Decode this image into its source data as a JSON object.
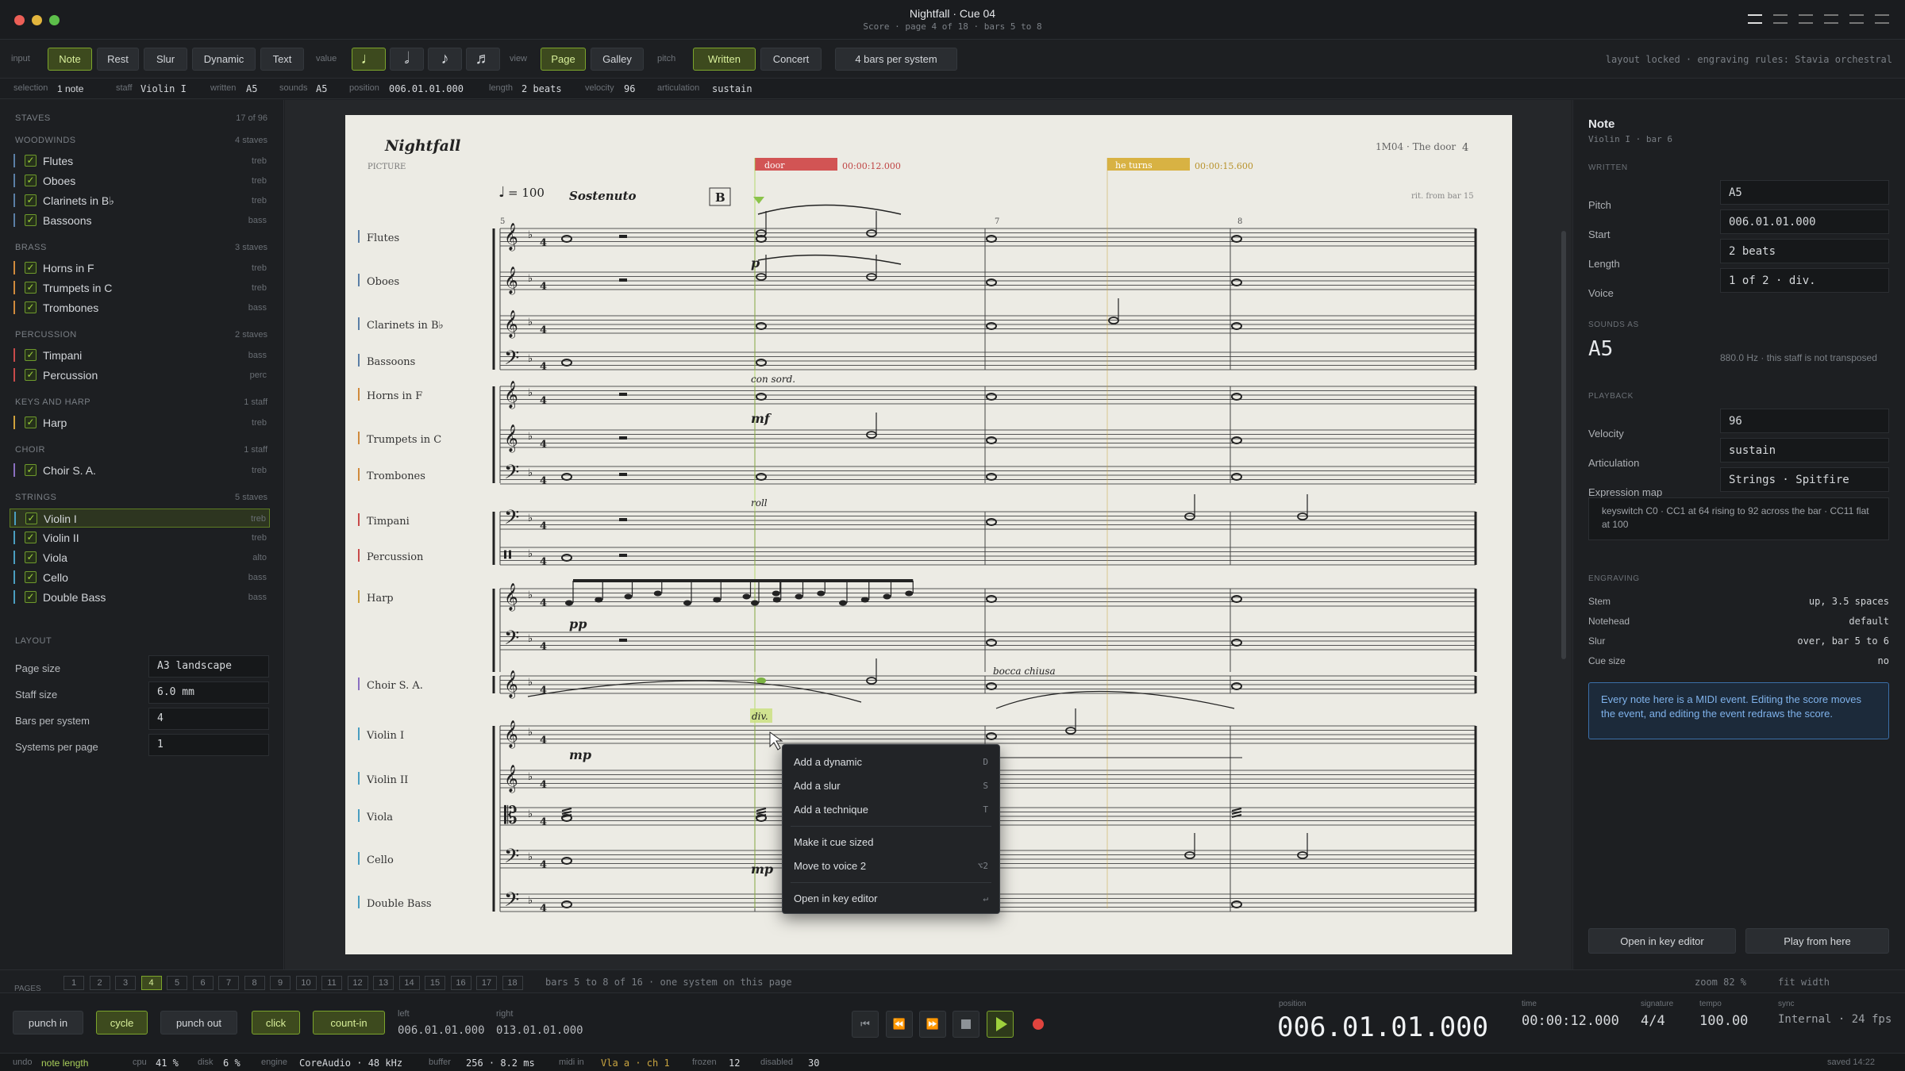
{
  "window": {
    "title": "Nightfall · Cue 04",
    "subtitle": "Score · page 4 of 18 · bars 5 to 8"
  },
  "toolbar": {
    "input_label": "input",
    "input_buttons": [
      "Note",
      "Rest",
      "Slur",
      "Dynamic",
      "Text"
    ],
    "value_label": "value",
    "view_label": "view",
    "view_buttons": [
      "Page",
      "Galley"
    ],
    "pitch_label": "pitch",
    "pitch_buttons": [
      "Written",
      "Concert"
    ],
    "bars_per_system": "4 bars per system",
    "right_status": "layout locked · engraving rules: Stavia orchestral"
  },
  "selection": {
    "selection_k": "selection",
    "selection_v": "1 note",
    "staff_k": "staff",
    "staff_v": "Violin I",
    "written_k": "written",
    "written_v": "A5",
    "sounds_k": "sounds",
    "sounds_v": "A5",
    "position_k": "position",
    "position_v": "006.01.01.000",
    "length_k": "length",
    "length_v": "2 beats",
    "velocity_k": "velocity",
    "velocity_v": "96",
    "articulation_k": "articulation",
    "articulation_v": "sustain"
  },
  "left": {
    "staves_title": "STAVES",
    "staves_count": "17 of 96",
    "groups": [
      {
        "name": "WOODWINDS",
        "count": "4 staves",
        "items": [
          {
            "n": "Flutes",
            "c": "treb"
          },
          {
            "n": "Oboes",
            "c": "treb"
          },
          {
            "n": "Clarinets in B♭",
            "c": "treb"
          },
          {
            "n": "Bassoons",
            "c": "bass"
          }
        ]
      },
      {
        "name": "BRASS",
        "count": "3 staves",
        "items": [
          {
            "n": "Horns in F",
            "c": "treb"
          },
          {
            "n": "Trumpets in C",
            "c": "treb"
          },
          {
            "n": "Trombones",
            "c": "bass"
          }
        ]
      },
      {
        "name": "PERCUSSION",
        "count": "2 staves",
        "items": [
          {
            "n": "Timpani",
            "c": "bass"
          },
          {
            "n": "Percussion",
            "c": "perc"
          }
        ]
      },
      {
        "name": "KEYS AND HARP",
        "count": "1 staff",
        "items": [
          {
            "n": "Harp",
            "c": "treb"
          }
        ]
      },
      {
        "name": "CHOIR",
        "count": "1 staff",
        "items": [
          {
            "n": "Choir S. A.",
            "c": "treb"
          }
        ]
      },
      {
        "name": "STRINGS",
        "count": "5 staves",
        "items": [
          {
            "n": "Violin I",
            "c": "treb"
          },
          {
            "n": "Violin II",
            "c": "treb"
          },
          {
            "n": "Viola",
            "c": "alto"
          },
          {
            "n": "Cello",
            "c": "bass"
          },
          {
            "n": "Double Bass",
            "c": "bass"
          }
        ]
      }
    ],
    "layout_title": "LAYOUT",
    "layout": [
      {
        "k": "Page size",
        "v": "A3 landscape"
      },
      {
        "k": "Staff size",
        "v": "6.0 mm"
      },
      {
        "k": "Bars per system",
        "v": "4"
      },
      {
        "k": "Systems per page",
        "v": "1"
      }
    ]
  },
  "score": {
    "title": "Nightfall",
    "picture": "PICTURE",
    "cue_ref": "1M04 · The door",
    "page_num": "4",
    "tempo": "= 100",
    "tempo_text": "Sostenuto",
    "rehearsal": "B",
    "marker1": "door",
    "marker1_time": "00:00:12.000",
    "marker2": "he turns",
    "marker2_time": "00:00:15.600",
    "rit": "rit. from bar 15",
    "bar_numbers": [
      "5",
      "7",
      "8"
    ],
    "instruments": [
      "Flutes",
      "Oboes",
      "Clarinets in B♭",
      "Bassoons",
      "Horns in F",
      "Trumpets in C",
      "Trombones",
      "Timpani",
      "Percussion",
      "Harp",
      "Choir S. A.",
      "Violin I",
      "Violin II",
      "Viola",
      "Cello",
      "Double Bass"
    ],
    "texts": {
      "p": "p",
      "con_sord": "con sord.",
      "mf": "mf",
      "roll": "roll",
      "pp": "pp",
      "bocca": "bocca chiusa",
      "div": "div.",
      "mp1": "mp",
      "mp2": "mp"
    }
  },
  "context_menu": [
    {
      "label": "Add a dynamic",
      "key": "D"
    },
    {
      "label": "Add a slur",
      "key": "S"
    },
    {
      "label": "Add a technique",
      "key": "T"
    },
    {
      "label": "Make it cue sized",
      "key": ""
    },
    {
      "label": "Move to voice 2",
      "key": "⌥2"
    },
    {
      "label": "Open in key editor",
      "key": "↵"
    }
  ],
  "right": {
    "title": "Note",
    "subtitle": "Violin I · bar 6",
    "written_title": "WRITTEN",
    "written": [
      {
        "k": "Pitch",
        "v": "A5"
      },
      {
        "k": "Start",
        "v": "006.01.01.000"
      },
      {
        "k": "Length",
        "v": "2 beats"
      },
      {
        "k": "Voice",
        "v": "1 of 2 · div."
      }
    ],
    "sounds_title": "SOUNDS AS",
    "sounds_pitch": "A5",
    "sounds_note": "880.0 Hz · this staff is not transposed",
    "playback_title": "PLAYBACK",
    "playback": [
      {
        "k": "Velocity",
        "v": "96"
      },
      {
        "k": "Articulation",
        "v": "sustain"
      },
      {
        "k": "Expression map",
        "v": "Strings · Spitfire"
      }
    ],
    "expression_note": "keyswitch C0 · CC1 at 64 rising to 92 across the bar · CC11 flat at 100",
    "engraving_title": "ENGRAVING",
    "engraving": [
      {
        "k": "Stem",
        "v": "up, 3.5 spaces"
      },
      {
        "k": "Notehead",
        "v": "default"
      },
      {
        "k": "Slur",
        "v": "over, bar 5 to 6"
      },
      {
        "k": "Cue size",
        "v": "no"
      }
    ],
    "info": "Every note here is a MIDI event. Editing the score moves the event, and editing the event redraws the score.",
    "btn_key_editor": "Open in key editor",
    "btn_play": "Play from here"
  },
  "pages": {
    "label": "PAGES",
    "items": [
      "1",
      "2",
      "3",
      "4",
      "5",
      "6",
      "7",
      "8",
      "9",
      "10",
      "11",
      "12",
      "13",
      "14",
      "15",
      "16",
      "17",
      "18"
    ],
    "current": "4",
    "info": "bars 5 to 8 of 16 · one system on this page",
    "zoom": "zoom 82 %",
    "fit": "fit width"
  },
  "transport": {
    "punch_in": "punch in",
    "cycle": "cycle",
    "punch_out": "punch out",
    "click": "click",
    "count_in": "count-in",
    "left_k": "left",
    "left_v": "006.01.01.000",
    "right_k": "right",
    "right_v": "013.01.01.000",
    "position_k": "position",
    "position_v": "006.01.01.000",
    "time_k": "time",
    "time_v": "00:00:12.000",
    "signature_k": "signature",
    "signature_v": "4/4",
    "tempo_k": "tempo",
    "tempo_v": "100.00",
    "sync_k": "sync",
    "sync_v": "Internal · 24 fps"
  },
  "status": {
    "undo_k": "undo",
    "undo_v": "note length",
    "cpu_k": "cpu",
    "cpu_v": "41 %",
    "disk_k": "disk",
    "disk_v": "6 %",
    "engine_k": "engine",
    "engine_v": "CoreAudio · 48 kHz",
    "buffer_k": "buffer",
    "buffer_v": "256 · 8.2 ms",
    "midi_k": "midi in",
    "midi_v": "Vla a · ch 1",
    "frozen_k": "frozen",
    "frozen_v": "12",
    "disabled_k": "disabled",
    "disabled_v": "30",
    "saved": "saved 14:22"
  },
  "colors": {
    "accent": "#9fd13d",
    "accent_bg": "#3d4a1e",
    "record": "#e0443e",
    "info": "#6fa3e0"
  }
}
